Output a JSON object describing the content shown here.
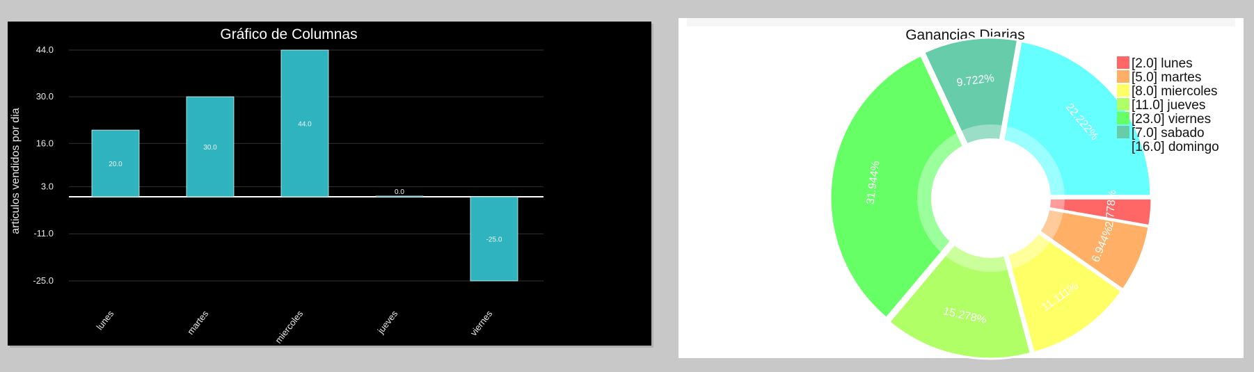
{
  "chart_data": [
    {
      "type": "bar",
      "title": "Gráfico de Columnas",
      "ylabel": "articulos vendidos por dia",
      "xlabel": "",
      "categories": [
        "lunes",
        "martes",
        "miercoles",
        "jueves",
        "viernes"
      ],
      "values": [
        20.0,
        30.0,
        44.0,
        0.0,
        -25.0
      ],
      "value_labels": [
        "20.0",
        "30.0",
        "44.0",
        "0.0",
        "-25.0"
      ],
      "yticks": [
        44.0,
        30.0,
        16.0,
        3.0,
        -11.0,
        -25.0
      ],
      "ytick_labels": [
        "44.0",
        "30.0",
        "16.0",
        "3.0",
        "-11.0",
        "-25.0"
      ],
      "ylim": [
        -25,
        44
      ],
      "grid": true,
      "colors": {
        "bar": "#2fb4bf",
        "bar_edge": "#e8f8f8",
        "background": "#000000",
        "grid": "#333333",
        "zero_line": "#ffffff"
      }
    },
    {
      "type": "pie",
      "variant": "donut",
      "title": "Ganancias Diarias",
      "legend_position": "top-right",
      "slices": [
        {
          "name": "lunes",
          "value": 2.0,
          "legend": "[2.0] lunes",
          "label": "2.778%",
          "color": "#ff6666"
        },
        {
          "name": "martes",
          "value": 5.0,
          "legend": "[5.0] martes",
          "label": "6.944%",
          "color": "#ffb066"
        },
        {
          "name": "miercoles",
          "value": 8.0,
          "legend": "[8.0] miercoles",
          "label": "11.111%",
          "color": "#ffff66"
        },
        {
          "name": "jueves",
          "value": 11.0,
          "legend": "[11.0] jueves",
          "label": "15.278%",
          "color": "#b0ff66"
        },
        {
          "name": "viernes",
          "value": 23.0,
          "legend": "[23.0] viernes",
          "label": "31.944%",
          "color": "#66ff66"
        },
        {
          "name": "sabado",
          "value": 7.0,
          "legend": "[7.0] sabado",
          "label": "9.722%",
          "color": "#66ccaa"
        },
        {
          "name": "domingo",
          "value": 16.0,
          "legend": "[16.0] domingo",
          "label": "22.222%",
          "color": "#66ffff"
        }
      ]
    }
  ]
}
